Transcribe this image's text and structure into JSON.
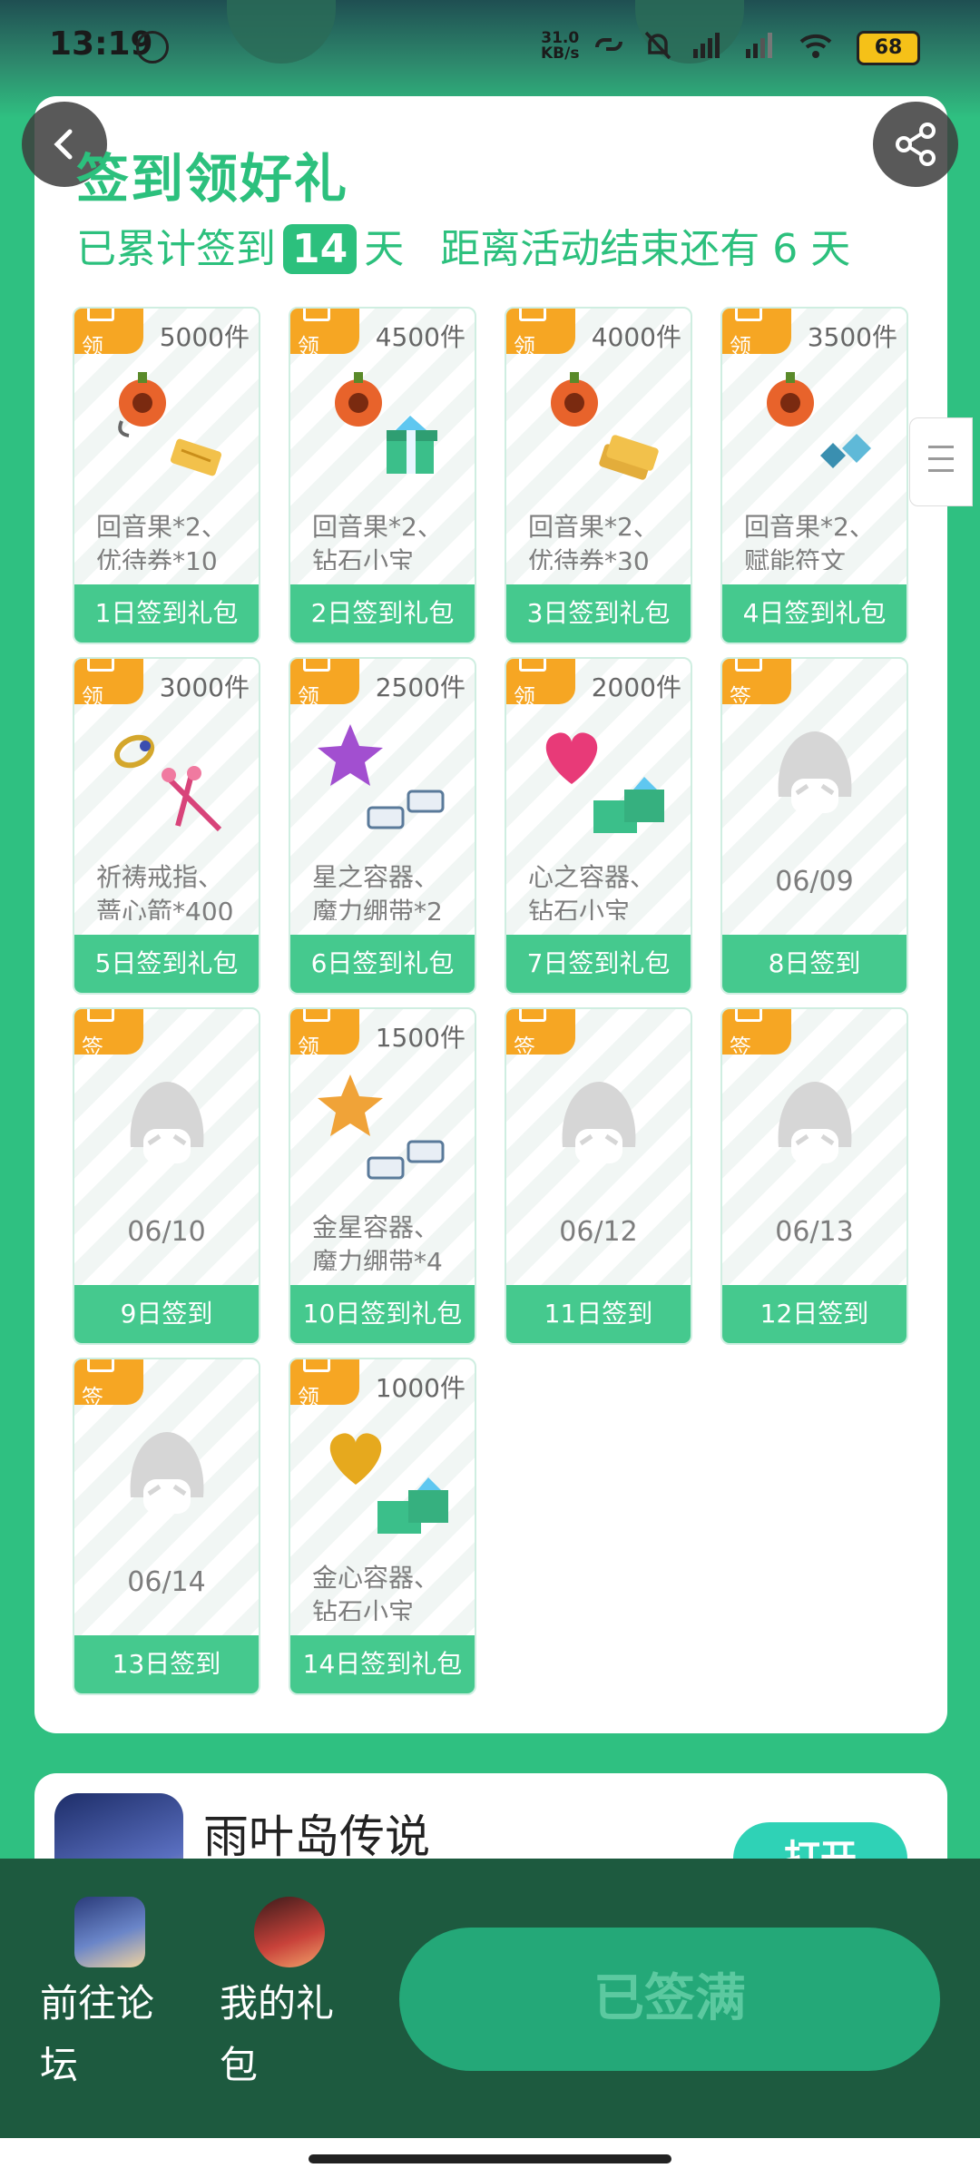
{
  "status_bar": {
    "time": "13:19",
    "net_speed_value": "31.0",
    "net_speed_unit": "KB/s",
    "battery": "68"
  },
  "header": {
    "title": "签到领好礼",
    "progress_prefix": "已累计签到",
    "signed_days": "14",
    "progress_days_unit": "天",
    "remaining_text": "距离活动结束还有 6 天"
  },
  "tiles": [
    {
      "tag": "领",
      "count": "5000件",
      "desc_line1": "回音果*2、",
      "desc_line2": "优待券*10",
      "bar": "1日签到礼包"
    },
    {
      "tag": "领",
      "count": "4500件",
      "desc_line1": "回音果*2、",
      "desc_line2": "钻石小宝",
      "bar": "2日签到礼包"
    },
    {
      "tag": "领",
      "count": "4000件",
      "desc_line1": "回音果*2、",
      "desc_line2": "优待券*30",
      "bar": "3日签到礼包"
    },
    {
      "tag": "领",
      "count": "3500件",
      "desc_line1": "回音果*2、",
      "desc_line2": "赋能符文",
      "bar": "4日签到礼包"
    },
    {
      "tag": "领",
      "count": "3000件",
      "desc_line1": "祈祷戒指、",
      "desc_line2": "蔷心箭*400",
      "bar": "5日签到礼包"
    },
    {
      "tag": "领",
      "count": "2500件",
      "desc_line1": "星之容器、",
      "desc_line2": "魔力绷带*2",
      "bar": "6日签到礼包"
    },
    {
      "tag": "领",
      "count": "2000件",
      "desc_line1": "心之容器、",
      "desc_line2": "钻石小宝",
      "bar": "7日签到礼包"
    },
    {
      "tag": "签",
      "date": "06/09",
      "bar": "8日签到"
    },
    {
      "tag": "签",
      "date": "06/10",
      "bar": "9日签到"
    },
    {
      "tag": "领",
      "count": "1500件",
      "desc_line1": "金星容器、",
      "desc_line2": "魔力绷带*4",
      "bar": "10日签到礼包"
    },
    {
      "tag": "签",
      "date": "06/12",
      "bar": "11日签到"
    },
    {
      "tag": "签",
      "date": "06/13",
      "bar": "12日签到"
    },
    {
      "tag": "签",
      "date": "06/14",
      "bar": "13日签到"
    },
    {
      "tag": "领",
      "count": "1000件",
      "desc_line1": "金心容器、",
      "desc_line2": "钻石小宝",
      "bar": "14日签到礼包"
    }
  ],
  "game": {
    "name": "雨叶岛传说",
    "open_label": "打开"
  },
  "bottom": {
    "forum_label_1": "前往论",
    "forum_label_2": "坛",
    "gift_label_1": "我的礼",
    "gift_label_2": "包",
    "signed_button": "已签满"
  },
  "colors": {
    "accent_green": "#2cc07d",
    "tag_orange": "#f6a623",
    "bottom_bar": "#1d5a3f"
  }
}
